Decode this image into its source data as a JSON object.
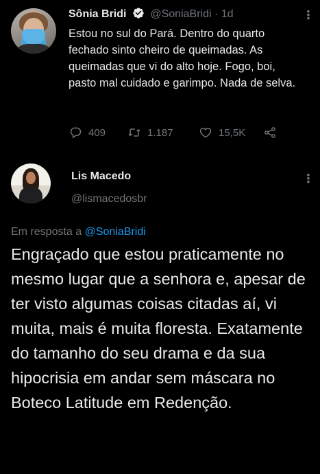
{
  "tweet1": {
    "author_name": "Sônia Bridi",
    "handle": "@SoniaBridi",
    "separator": "·",
    "time": "1d",
    "text": "Estou no sul do Pará. Dentro do quarto fechado sinto cheiro de queimadas. As queimadas que vi do alto hoje. Fogo, boi, pasto mal cuidado e garimpo. Nada de selva.",
    "replies": "409",
    "retweets": "1.187",
    "likes": "15,5K",
    "icons": [
      "reply-icon",
      "retweet-icon",
      "like-icon",
      "share-icon",
      "verified-badge-icon",
      "more-icon"
    ]
  },
  "tweet2": {
    "author_name": "Lis Macedo",
    "handle": "@lismacedosbr",
    "reply_prefix": "Em resposta a",
    "reply_handle": "@SoniaBridi",
    "text": "Engraçado que estou praticamente no mesmo lugar que a senhora e, apesar de ter visto algumas coisas citadas aí, vi muita, mais é muita floresta. Exatamente do tamanho do seu drama e da sua hipocrisia em andar sem máscara no Boteco Latitude em Redenção."
  },
  "colors": {
    "background": "#000000",
    "text": "#e7e9ea",
    "secondary": "#71767b",
    "link": "#1d9bf0"
  }
}
